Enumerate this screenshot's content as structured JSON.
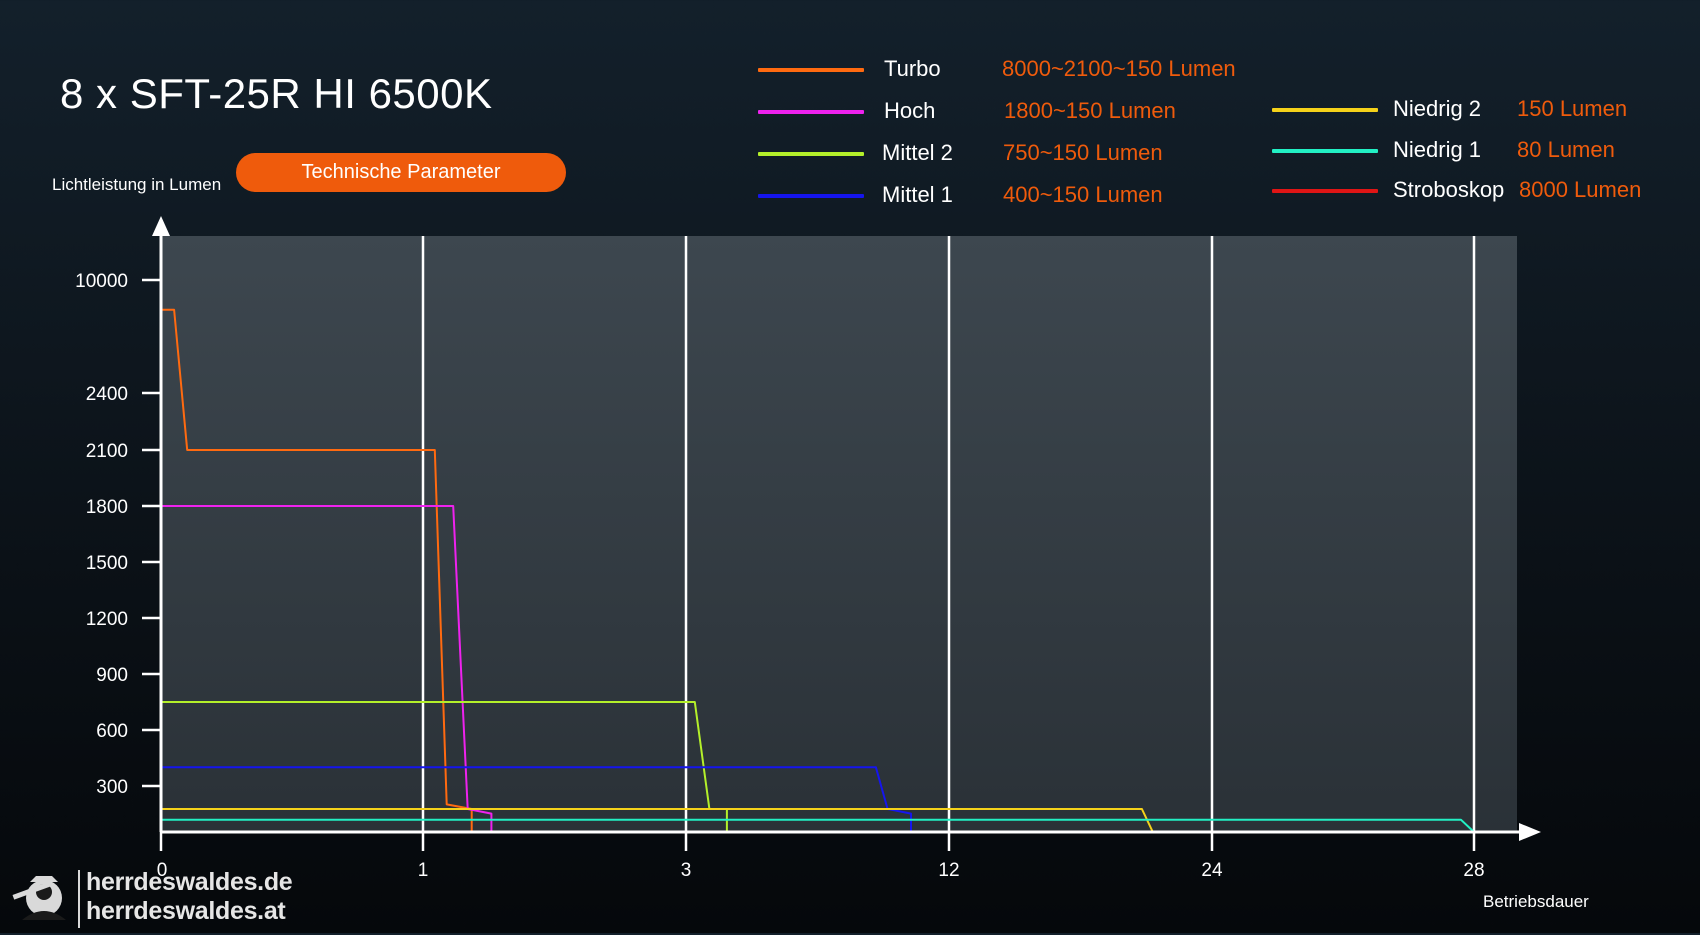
{
  "title": "8 x SFT-25R HI 6500K",
  "badge_label": "Technische Parameter",
  "logo": {
    "line1": "herrdeswaldes.de",
    "line2": "herrdeswaldes.at"
  },
  "legend": [
    {
      "name": "Turbo",
      "value": "8000~2100~150 Lumen",
      "color": "#ff6a10"
    },
    {
      "name": "Hoch",
      "value": "1800~150 Lumen",
      "color": "#ee22ee"
    },
    {
      "name": "Mittel 2",
      "value": "750~150 Lumen",
      "color": "#b4f02a"
    },
    {
      "name": "Mittel 1",
      "value": "400~150 Lumen",
      "color": "#1515ee"
    },
    {
      "name": "Niedrig 2",
      "value": "150 Lumen",
      "color": "#f5d21a"
    },
    {
      "name": "Niedrig 1",
      "value": "80 Lumen",
      "color": "#22f0c4"
    },
    {
      "name": "Stroboskop",
      "value": "8000 Lumen",
      "color": "#e01515"
    }
  ],
  "chart_data": {
    "type": "line",
    "title": "8 x SFT-25R HI 6500K",
    "ylabel": "Lichtleistung in Lumen",
    "xlabel": "Betriebsdauer",
    "x_ticks": [
      "0",
      "1",
      "3",
      "12",
      "24",
      "28"
    ],
    "y_ticks": [
      "10000",
      "2400",
      "2100",
      "1800",
      "1500",
      "1200",
      "900",
      "600",
      "300"
    ],
    "grid": "vertical",
    "series": [
      {
        "name": "Turbo",
        "color": "#ff6a10",
        "points": [
          [
            0,
            8000
          ],
          [
            0.05,
            8000
          ],
          [
            0.1,
            2100
          ],
          [
            1.09,
            2100
          ],
          [
            1.18,
            180
          ],
          [
            1.37,
            150
          ],
          [
            1.37,
            0
          ]
        ]
      },
      {
        "name": "Hoch",
        "color": "#ee22ee",
        "points": [
          [
            0,
            1800
          ],
          [
            1.23,
            1800
          ],
          [
            1.34,
            150
          ],
          [
            1.52,
            120
          ],
          [
            1.52,
            0
          ]
        ]
      },
      {
        "name": "Mittel 2",
        "color": "#b4f02a",
        "points": [
          [
            0,
            750
          ],
          [
            3.3,
            750
          ],
          [
            3.8,
            150
          ],
          [
            4.4,
            150
          ],
          [
            4.4,
            0
          ]
        ]
      },
      {
        "name": "Mittel 1",
        "color": "#1515ee",
        "points": [
          [
            0,
            400
          ],
          [
            9.5,
            400
          ],
          [
            9.9,
            150
          ],
          [
            10.7,
            120
          ],
          [
            10.7,
            0
          ]
        ]
      },
      {
        "name": "Niedrig 2",
        "color": "#f5d21a",
        "points": [
          [
            0,
            150
          ],
          [
            20.8,
            150
          ],
          [
            21.3,
            0
          ]
        ]
      },
      {
        "name": "Niedrig 1",
        "color": "#22f0c4",
        "points": [
          [
            0,
            80
          ],
          [
            27.8,
            80
          ],
          [
            28,
            0
          ]
        ]
      }
    ]
  }
}
